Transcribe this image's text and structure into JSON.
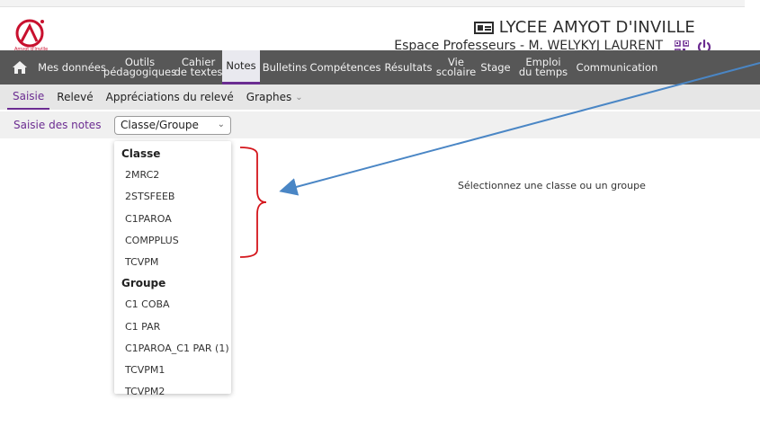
{
  "header": {
    "school_name": "LYCEE AMYOT D'INVILLE",
    "space_label": "Espace Professeurs - M. WELYKYJ LAURENT",
    "logo_caption": "Amyot d'Inville",
    "accent": "#c8102e"
  },
  "nav": {
    "items": [
      {
        "label": "Mes données"
      },
      {
        "label": "Outils\npédagogiques"
      },
      {
        "label": "Cahier\nde textes"
      },
      {
        "label": "Notes"
      },
      {
        "label": "Bulletins"
      },
      {
        "label": "Compétences"
      },
      {
        "label": "Résultats"
      },
      {
        "label": "Vie\nscolaire"
      },
      {
        "label": "Stage"
      },
      {
        "label": "Emploi\ndu temps"
      },
      {
        "label": "Communication"
      }
    ],
    "active": "Notes",
    "active_color": "#6b2c91"
  },
  "subnav": {
    "items": [
      {
        "label": "Saisie"
      },
      {
        "label": "Relevé"
      },
      {
        "label": "Appréciations du relevé"
      },
      {
        "label": "Graphes"
      }
    ]
  },
  "toolbar": {
    "label": "Saisie des notes",
    "select_value": "Classe/Groupe"
  },
  "dropdown": {
    "classe_title": "Classe",
    "classe": [
      "2MRC2",
      "2STSFEEB",
      "C1PAROA",
      "COMPPLUS",
      "TCVPM"
    ],
    "groupe_title": "Groupe",
    "groupe": [
      "C1 COBA",
      "C1 PAR",
      "C1PAROA_C1 PAR (1)",
      "TCVPM1",
      "TCVPM2"
    ]
  },
  "main": {
    "message": "Sélectionnez une classe ou un groupe"
  },
  "annotation": {
    "bracket_color": "#d4151b",
    "arrow_color": "#4a86c5"
  }
}
